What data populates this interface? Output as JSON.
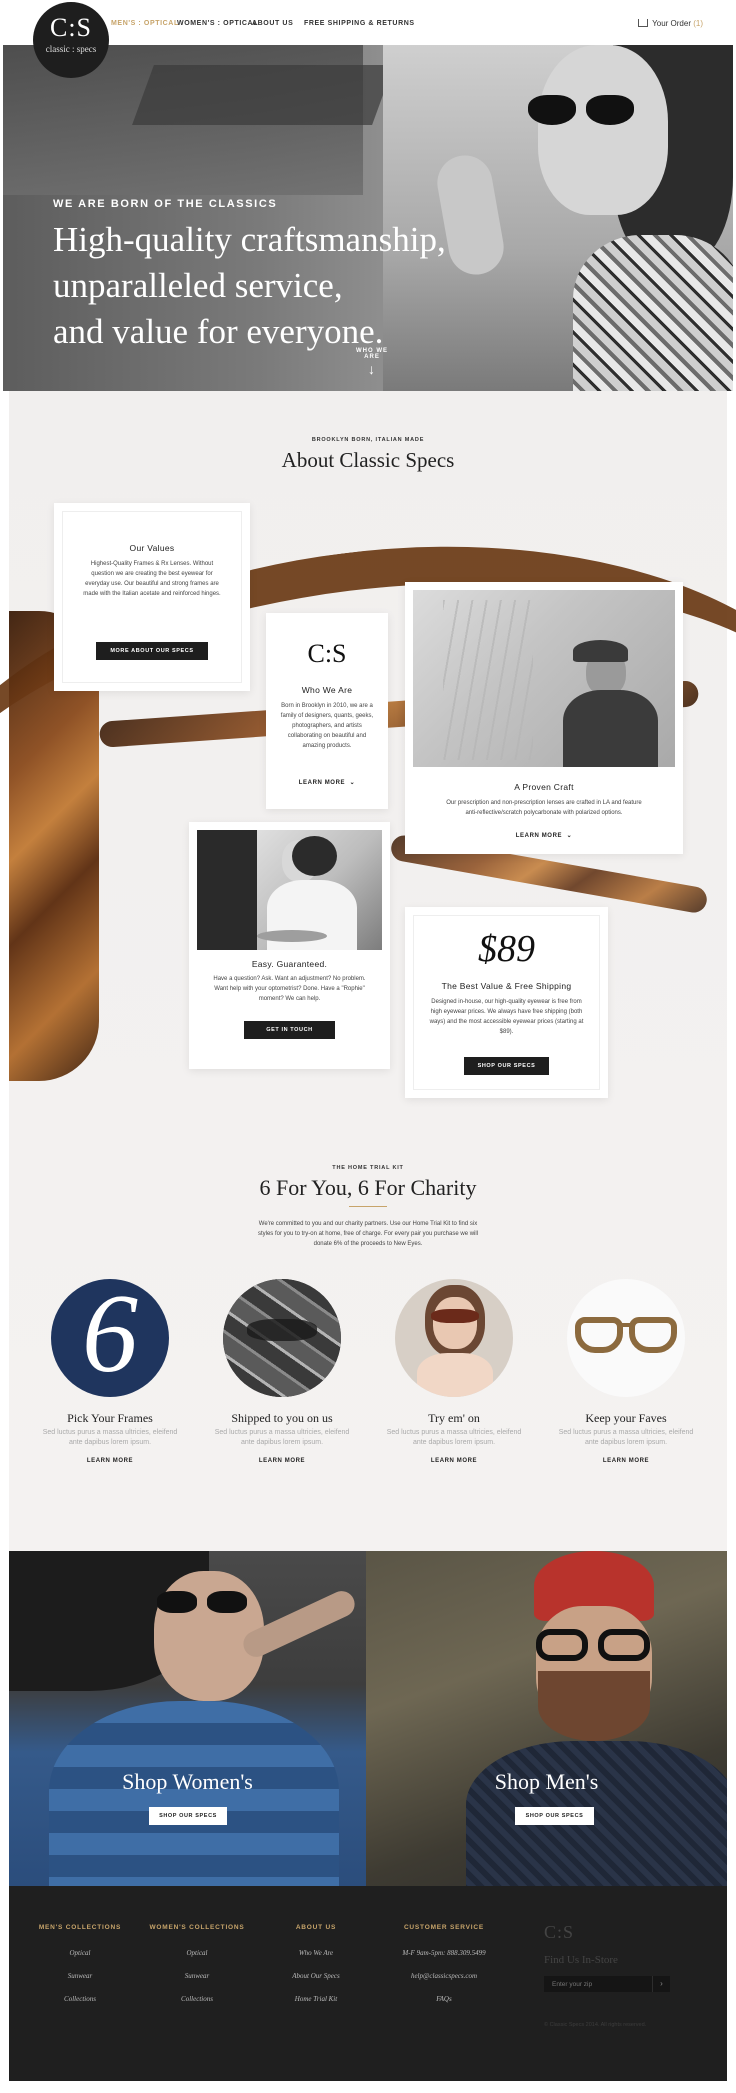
{
  "brand": {
    "mark": "C:S",
    "name": "classic : specs"
  },
  "nav": {
    "links": [
      "MEN'S : OPTICAL",
      "WOMEN'S : OPTICAL",
      "ABOUT US",
      "FREE SHIPPING & RETURNS"
    ],
    "active_index": 0,
    "order_label": "Your Order",
    "order_count": "(1)",
    "cart_icon": "cart-icon"
  },
  "hero": {
    "kicker": "WE ARE BORN OF THE CLASSICS",
    "lines": [
      "High-quality craftsmanship,",
      "unparalleled service,",
      "and value for everyone."
    ],
    "cta": "WHO WE ARE",
    "cta_icon": "arrow-down-icon"
  },
  "about": {
    "kicker": "BROOKLYN BORN, ITALIAN MADE",
    "title": "About Classic Specs",
    "values_card": {
      "title": "Our Values",
      "text": "Highest-Quality Frames & Rx Lenses. Without question we are creating the best eyewear for everyday use. Our beautiful and strong frames are made with the Italian acetate and reinforced hinges.",
      "button": "MORE ABOUT OUR SPECS"
    },
    "who_card": {
      "mark": "C:S",
      "title": "Who We Are",
      "text": "Born in Brooklyn in 2010, we are a family of designers, quants, geeks, photographers, and artists collaborating on beautiful and amazing products.",
      "link": "LEARN MORE"
    },
    "craft_card": {
      "title": "A Proven Craft",
      "text": "Our prescription and non-prescription lenses are crafted in LA and feature anti-reflective/scratch polycarbonate with polarized options.",
      "link": "LEARN MORE"
    },
    "easy_card": {
      "title": "Easy. Guaranteed.",
      "text": "Have a question? Ask. Want an adjustment? No problem. Want help with your optometrist? Done. Have a \"Rophie\" moment? We can help.",
      "button": "GET IN TOUCH"
    },
    "value_card": {
      "price": "$89",
      "title": "The Best Value & Free Shipping",
      "text": "Designed in-house, our high-quality eyewear is free from high eyewear prices. We always have free shipping (both ways) and the most accessible eyewear prices (starting at $89).",
      "button": "SHOP OUR SPECS"
    }
  },
  "trial": {
    "kicker": "THE HOME TRIAL KIT",
    "title": "6 For You, 6 For Charity",
    "text": "We're committed to you and our charity partners. Use our Home Trial Kit to find six styles for you to try-on at home, free of charge. For every pair you purchase we will donate 6% of the proceeds to New Eyes.",
    "steps": [
      {
        "numeral": "6",
        "title": "Pick Your Frames",
        "text": "Sed luctus purus a massa ultricies, eleifend ante dapibus lorem ipsum.",
        "link": "LEARN MORE"
      },
      {
        "title": "Shipped to you on us",
        "text": "Sed luctus purus a massa ultricies, eleifend ante dapibus lorem ipsum.",
        "link": "LEARN MORE"
      },
      {
        "title": "Try em' on",
        "text": "Sed luctus purus a massa ultricies, eleifend ante dapibus lorem ipsum.",
        "link": "LEARN MORE"
      },
      {
        "title": "Keep your Faves",
        "text": "Sed luctus purus a massa ultricies, eleifend ante dapibus lorem ipsum.",
        "link": "LEARN MORE"
      }
    ]
  },
  "shop": {
    "women": {
      "title": "Shop Women's",
      "button": "SHOP OUR SPECS"
    },
    "men": {
      "title": "Shop Men's",
      "button": "SHOP OUR SPECS"
    }
  },
  "footer": {
    "columns": [
      {
        "heading": "MEN'S COLLECTIONS",
        "links": [
          "Optical",
          "Sunwear",
          "Collections"
        ]
      },
      {
        "heading": "WOMEN'S COLLECTIONS",
        "links": [
          "Optical",
          "Sunwear",
          "Collections"
        ]
      },
      {
        "heading": "ABOUT US",
        "links": [
          "Who We Are",
          "About Our Specs",
          "Home Trial Kit"
        ]
      },
      {
        "heading": "CUSTOMER SERVICE",
        "links": [
          "M-F 9am-5pm: 888.309.5499",
          "help@classicspecs.com",
          "FAQs"
        ]
      }
    ],
    "logo": "C:S",
    "find_heading": "Find Us In-Store",
    "zip_placeholder": "Enter your zip",
    "go": "›",
    "copyright": "© Classic Specs 2014. All rights reserved."
  },
  "colors": {
    "accent": "#c7a46a",
    "dark": "#1e1e1e",
    "navy": "#1f355e"
  }
}
